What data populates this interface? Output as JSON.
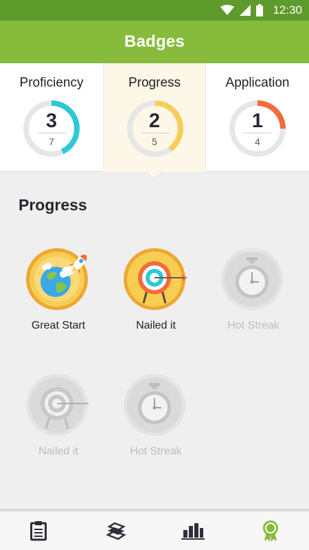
{
  "status_bar": {
    "time": "12:30",
    "icons": [
      "wifi-icon",
      "cell-signal-icon",
      "battery-icon"
    ]
  },
  "header": {
    "title": "Badges"
  },
  "summary": [
    {
      "label": "Proficiency",
      "count": "3",
      "total": "7",
      "progress": 0.43,
      "color": "#2ec9d8"
    },
    {
      "label": "Progress",
      "count": "2",
      "total": "5",
      "progress": 0.4,
      "color": "#f6cd57"
    },
    {
      "label": "Application",
      "count": "1",
      "total": "4",
      "progress": 0.25,
      "color": "#f36b3b"
    }
  ],
  "selected_category": "Progress",
  "section": {
    "title": "Progress"
  },
  "badges": [
    {
      "label": "Great Start",
      "unlocked": true,
      "icon": "rocket-globe-icon"
    },
    {
      "label": "Nailed it",
      "unlocked": true,
      "icon": "target-icon"
    },
    {
      "label": "Hot Streak",
      "unlocked": false,
      "icon": "stopwatch-icon"
    },
    {
      "label": "Nailed it",
      "unlocked": false,
      "icon": "target-icon"
    },
    {
      "label": "Hot Streak",
      "unlocked": false,
      "icon": "stopwatch-icon"
    }
  ],
  "bottom_nav": [
    {
      "icon": "clipboard-icon",
      "active": false
    },
    {
      "icon": "books-icon",
      "active": false
    },
    {
      "icon": "bar-chart-icon",
      "active": false
    },
    {
      "icon": "award-ribbon-icon",
      "active": true
    }
  ],
  "colors": {
    "status_bar": "#5e9a2c",
    "app_bar": "#86bb3c",
    "selected_tab_bg": "#fdf7e7",
    "nav_active": "#86bb3c",
    "nav_inactive": "#2d2f3a"
  }
}
